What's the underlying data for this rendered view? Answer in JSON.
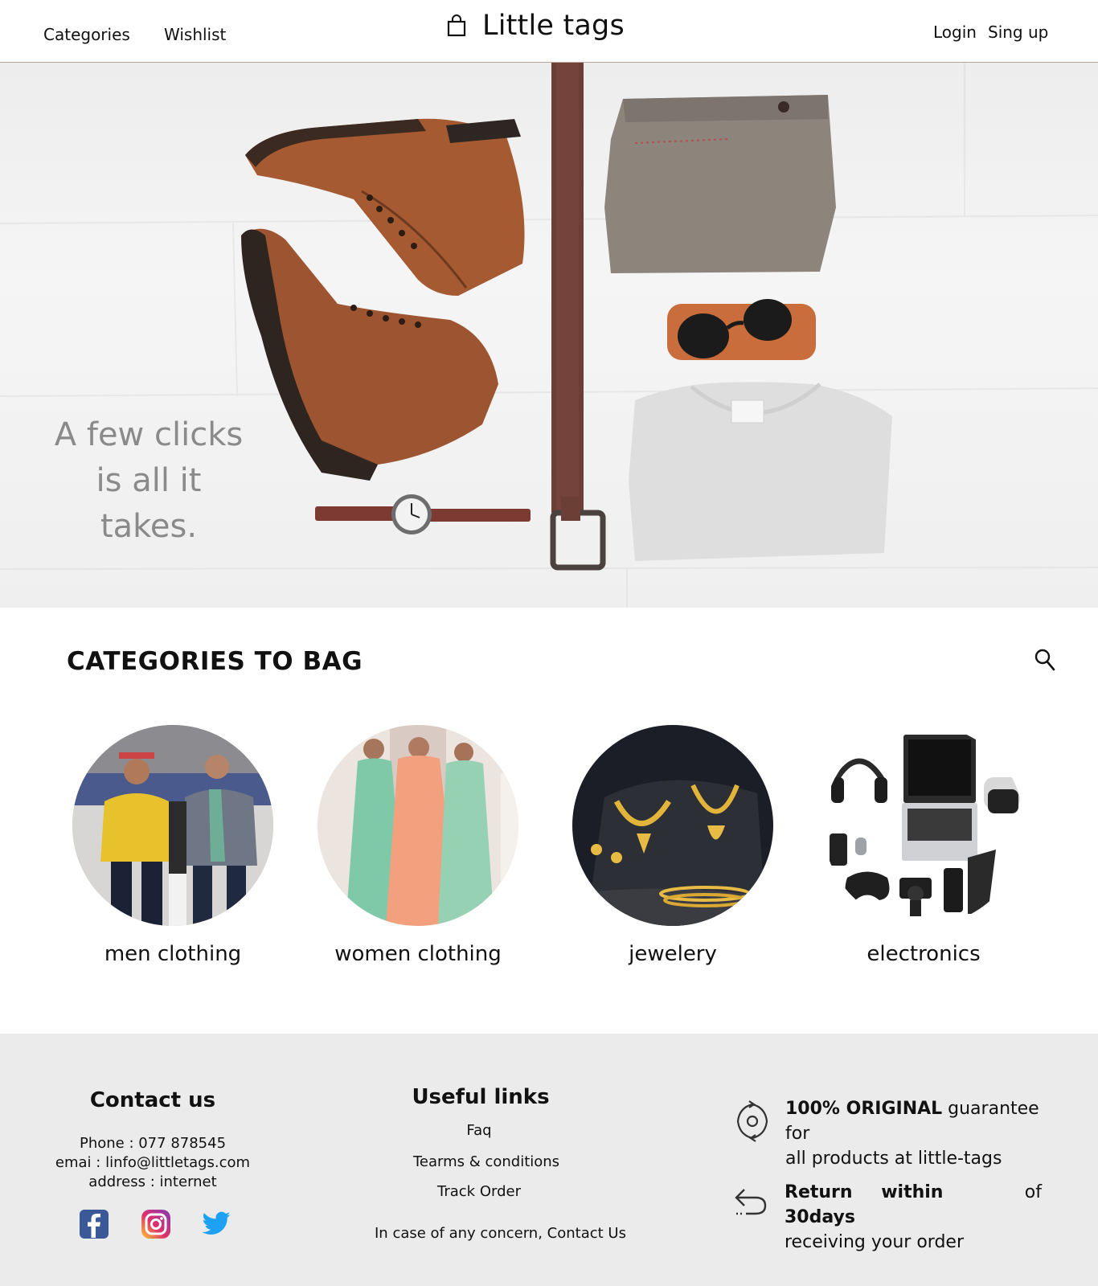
{
  "header": {
    "nav": {
      "categories": "Categories",
      "wishlist": "Wishlist"
    },
    "brand": {
      "icon": "shopping-bag-icon",
      "title": "Little tags"
    },
    "auth": {
      "login": "Login",
      "signup": "Sing up"
    }
  },
  "hero": {
    "tagline": [
      "A few clicks",
      "is all it",
      "takes."
    ]
  },
  "categories": {
    "title": "CATEGORIES TO BAG",
    "search_icon": "search-icon",
    "items": [
      {
        "label": "men clothing"
      },
      {
        "label": "women clothing"
      },
      {
        "label": "jewelery"
      },
      {
        "label": "electronics"
      }
    ]
  },
  "footer": {
    "contact": {
      "heading": "Contact us",
      "phone": "Phone  : 077 878545",
      "email": "emai : linfo@littletags.com",
      "address": "address : internet"
    },
    "social": [
      "facebook-icon",
      "instagram-icon",
      "twitter-icon"
    ],
    "useful_links": {
      "heading": "Useful links",
      "links": [
        "Faq",
        "Tearms & conditions",
        "Track Order"
      ],
      "concern": "In case of any concern, Contact Us"
    },
    "guarantees": {
      "original_bold": "100% ORIGINAL",
      "original_rest": " guarantee for",
      "original_line2": "all products at little-tags",
      "return_bold": "Return within 30days",
      "return_rest": "of",
      "return_line2": "receiving your order"
    }
  },
  "colors": {
    "footer_bg": "#ebebeb",
    "tagline": "#8a8a8a",
    "facebook": "#3b5998",
    "twitter": "#1da1f2"
  }
}
